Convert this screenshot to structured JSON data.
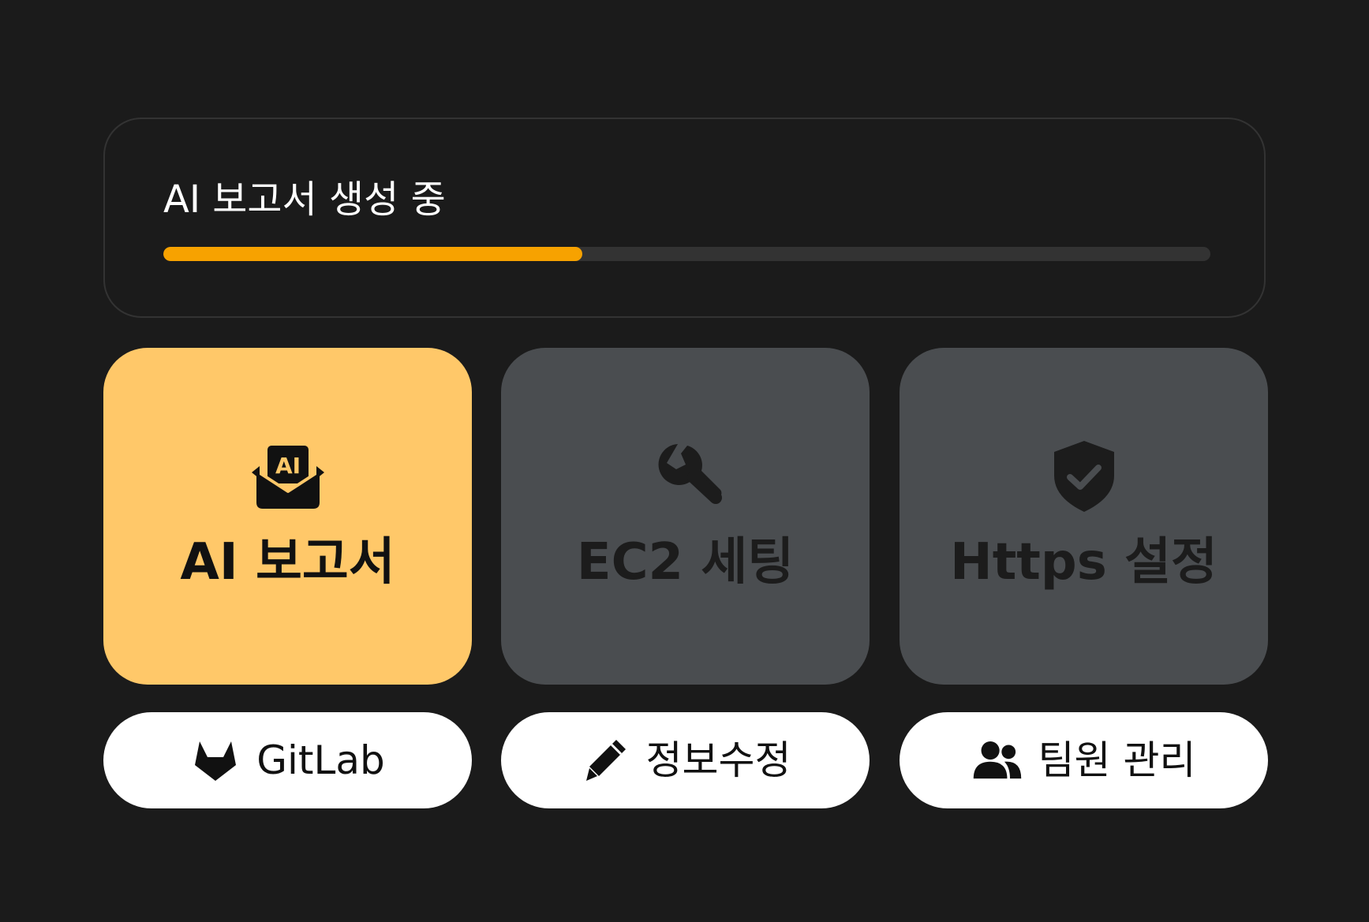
{
  "progress": {
    "title": "AI 보고서 생성 중",
    "value": 0.4,
    "fill_color": "#f7a200",
    "track_color": "#333333"
  },
  "tiles": [
    {
      "label": "AI 보고서",
      "icon": "ai-envelope-icon",
      "bg": "#ffc869",
      "fg": "#111111",
      "active": true
    },
    {
      "label": "EC2 세팅",
      "icon": "wrench-icon",
      "bg": "#4a4d50",
      "fg": "#1c1c1c",
      "active": false
    },
    {
      "label": "Https 설정",
      "icon": "shield-check-icon",
      "bg": "#4a4d50",
      "fg": "#1c1c1c",
      "active": false
    }
  ],
  "actions": [
    {
      "label": "GitLab",
      "icon": "gitlab-icon"
    },
    {
      "label": "정보수정",
      "icon": "pencil-icon"
    },
    {
      "label": "팀원 관리",
      "icon": "users-icon"
    }
  ],
  "colors": {
    "background": "#1b1b1b",
    "panel_border": "#333333",
    "pill_bg": "#ffffff"
  }
}
